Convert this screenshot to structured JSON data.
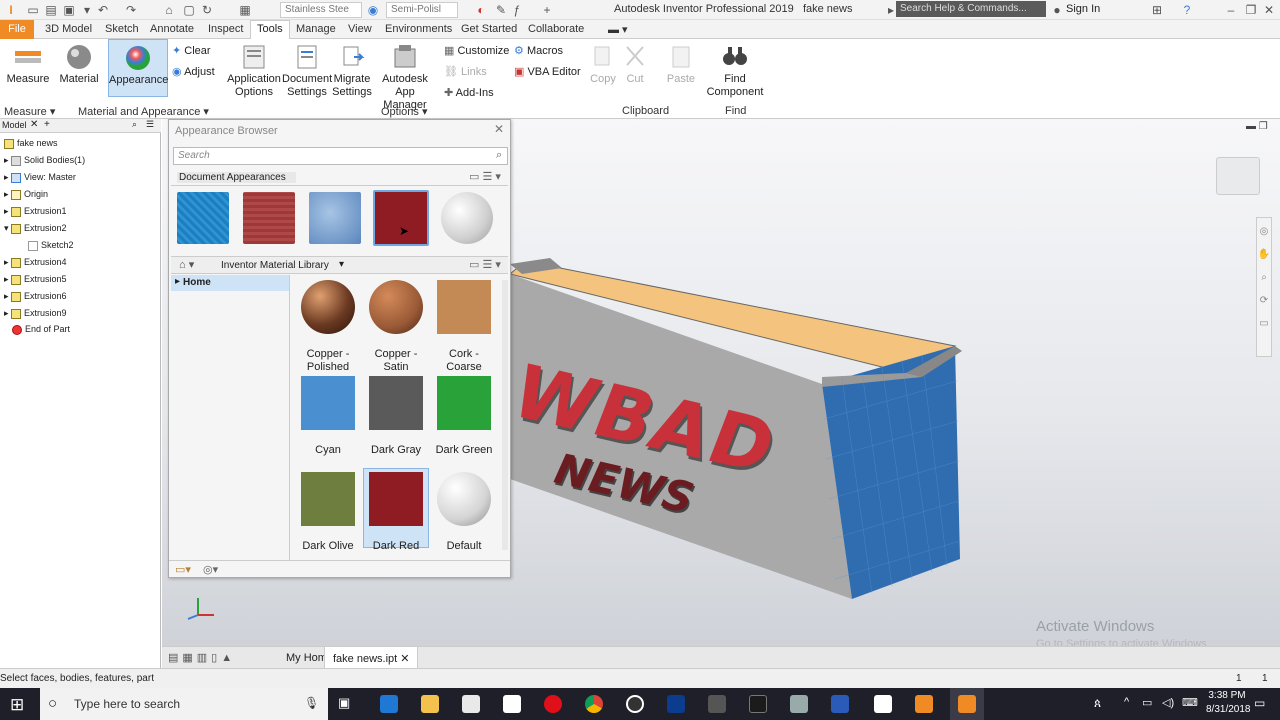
{
  "window": {
    "title": "Autodesk Inventor Professional 2019",
    "document": "fake news",
    "search_placeholder": "Search Help & Commands...",
    "sign_in": "Sign In",
    "material_dropdown": "Stainless Stee",
    "appearance_dropdown": "Semi-Polisl"
  },
  "menu": {
    "file": "File",
    "tabs": [
      "3D Model",
      "Sketch",
      "Annotate",
      "Inspect",
      "Tools",
      "Manage",
      "View",
      "Environments",
      "Get Started",
      "Collaborate"
    ]
  },
  "ribbon": {
    "measure": "Measure",
    "material": "Material",
    "appearance": "Appearance",
    "clear": "Clear",
    "adjust": "Adjust",
    "application_options": "Application Options",
    "document_settings": "Document Settings",
    "migrate_settings": "Migrate Settings",
    "app_manager": "Autodesk App Manager",
    "customize": "Customize",
    "macros": "Macros",
    "links": "Links",
    "vba_editor": "VBA Editor",
    "add_ins": "Add-Ins",
    "copy": "Copy",
    "cut": "Cut",
    "paste": "Paste",
    "find_component": "Find Component",
    "groups": {
      "measure": "Measure",
      "material_appearance": "Material and Appearance",
      "options": "Options",
      "clipboard": "Clipboard",
      "find": "Find"
    }
  },
  "model_panel": {
    "tab": "Model",
    "items": [
      {
        "label": "fake news"
      },
      {
        "label": "Solid Bodies(1)"
      },
      {
        "label": "View: Master"
      },
      {
        "label": "Origin"
      },
      {
        "label": "Extrusion1"
      },
      {
        "label": "Extrusion2"
      },
      {
        "label": "Sketch2"
      },
      {
        "label": "Extrusion4"
      },
      {
        "label": "Extrusion5"
      },
      {
        "label": "Extrusion6"
      },
      {
        "label": "Extrusion9"
      },
      {
        "label": "End of Part"
      }
    ]
  },
  "appearance_browser": {
    "title": "Appearance Browser",
    "search_placeholder": "Search",
    "document_appearances": "Document Appearances",
    "library": "Inventor Material Library",
    "home": "Home",
    "items": [
      {
        "label": "Copper - Polished",
        "color": "#6b3a22"
      },
      {
        "label": "Copper - Satin",
        "color": "#9a5a36"
      },
      {
        "label": "Cork - Coarse",
        "color": "#c48a55"
      },
      {
        "label": "Cyan",
        "color": "#4a8fd0"
      },
      {
        "label": "Dark Gray",
        "color": "#5a5a5a"
      },
      {
        "label": "Dark Green",
        "color": "#2aa23a"
      },
      {
        "label": "Dark Olive",
        "color": "#6e7e3e"
      },
      {
        "label": "Dark Red",
        "color": "#8e1c22"
      },
      {
        "label": "Default",
        "color": "#e4e4e4"
      }
    ]
  },
  "viewport": {
    "text_main": "WBAD",
    "text_sub": "NEWS",
    "watermark_title": "Activate Windows",
    "watermark_sub": "Go to Settings to activate Windows."
  },
  "bottom_tabs": {
    "home": "My Home",
    "file": "fake news.ipt"
  },
  "status": {
    "text": "Select faces, bodies, features, part",
    "count1": "1",
    "count2": "1"
  },
  "taskbar": {
    "search": "Type here to search",
    "time": "3:38 PM",
    "date": "8/31/2018"
  }
}
